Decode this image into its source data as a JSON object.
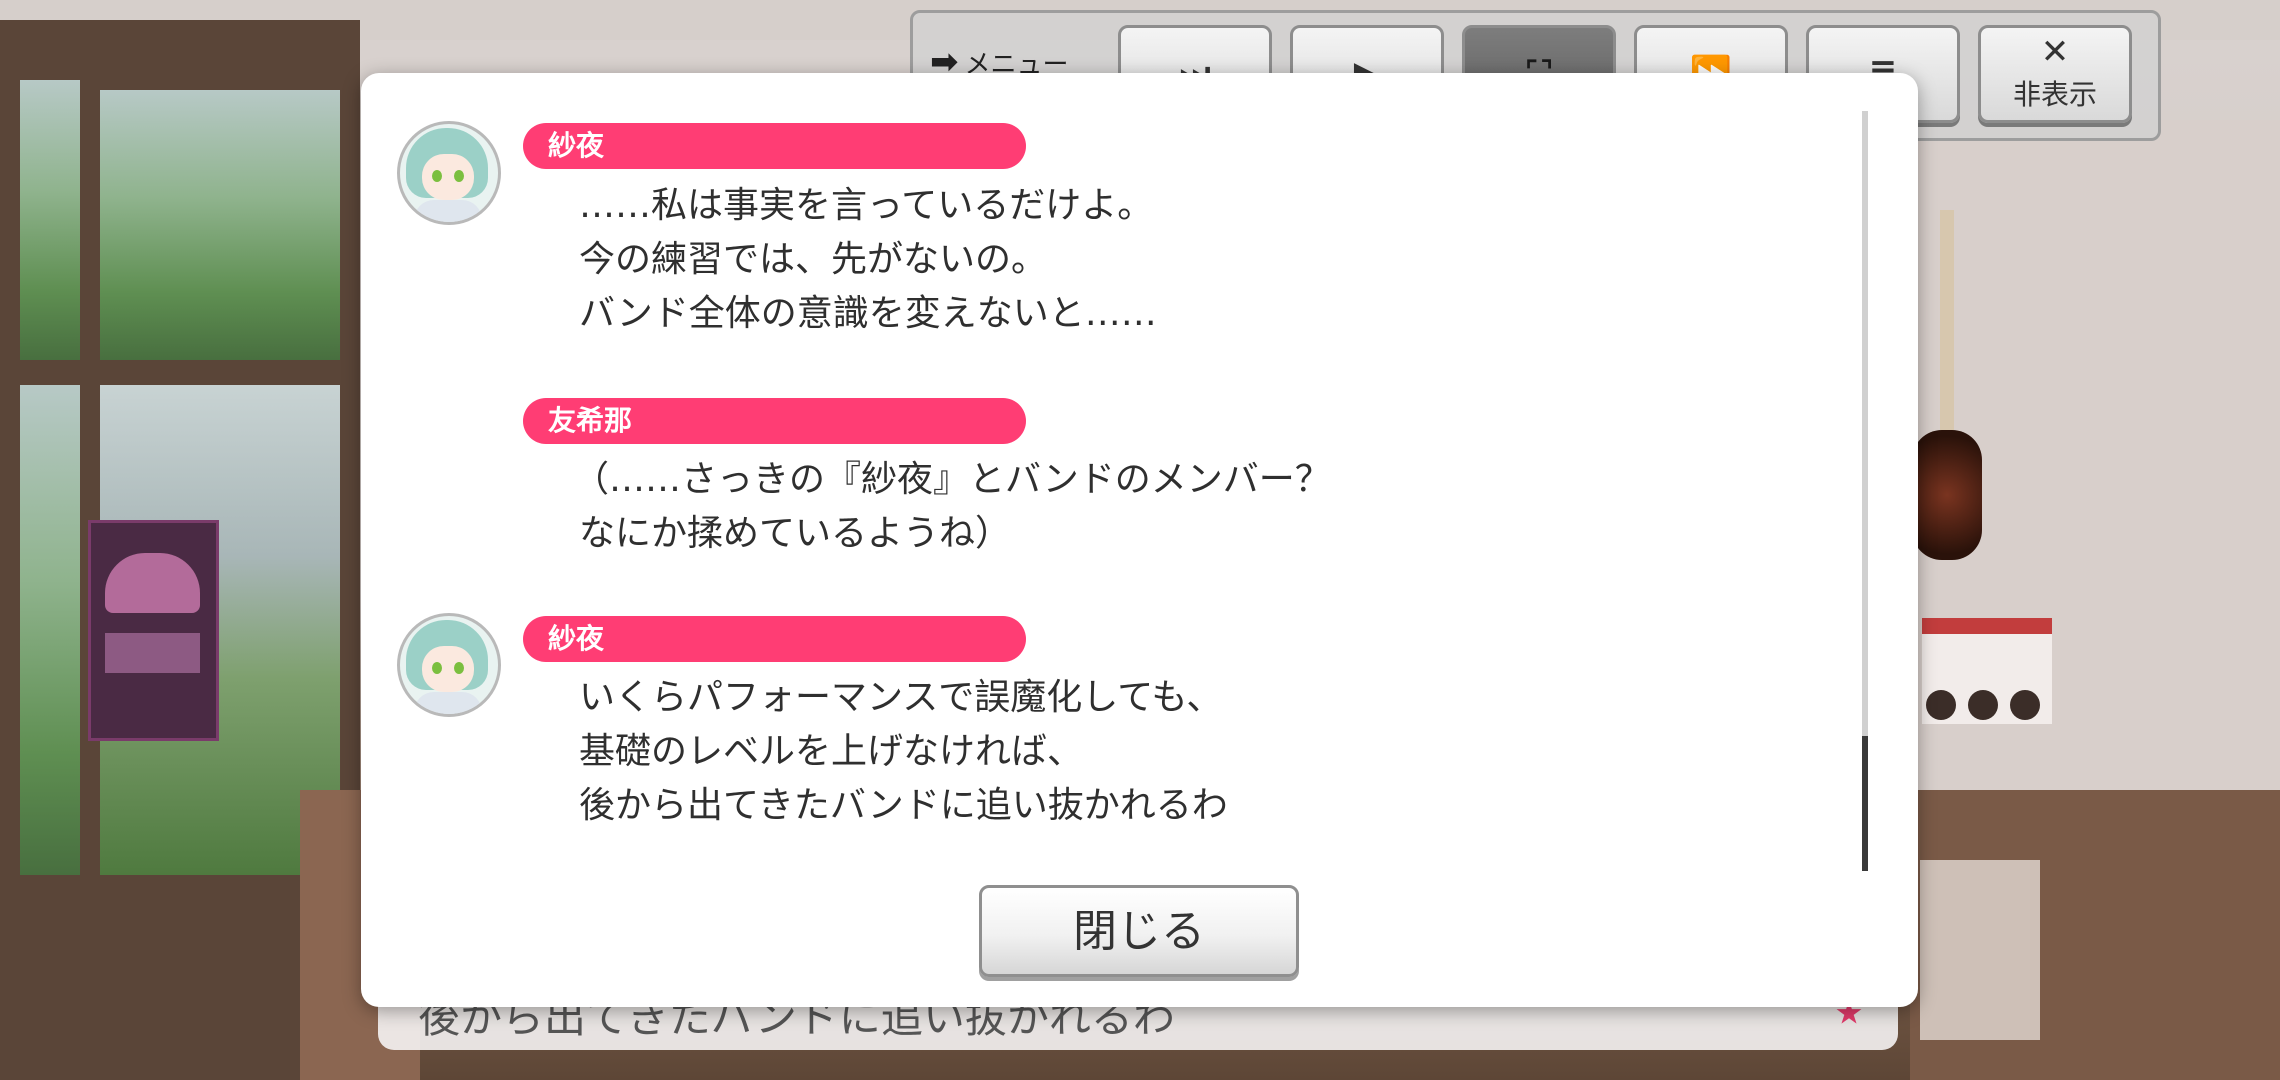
{
  "toolbar": {
    "menu_label": "メニュー",
    "buttons": [
      {
        "icon": "skip-icon",
        "glyph": "⏭"
      },
      {
        "icon": "play-icon",
        "glyph": "▶"
      },
      {
        "icon": "fullscreen-play-icon",
        "glyph": "⛶"
      },
      {
        "icon": "fast-forward-icon",
        "glyph": "⏩"
      },
      {
        "icon": "log-icon",
        "glyph": "≣"
      },
      {
        "icon": "close-icon",
        "glyph": "✕",
        "label": "非表示"
      }
    ]
  },
  "message_box": {
    "text": "後から出てきたバンドに追い抜かれるわ"
  },
  "log": {
    "entries": [
      {
        "speaker": "紗夜",
        "has_avatar": true,
        "lines": [
          "……私は事実を言っているだけよ。",
          "今の練習では、先がないの。",
          "バンド全体の意識を変えないと……"
        ]
      },
      {
        "speaker": "友希那",
        "has_avatar": false,
        "lines": [
          "（……さっきの『紗夜』とバンドのメンバー？",
          "なにか揉めているようね）"
        ]
      },
      {
        "speaker": "紗夜",
        "has_avatar": true,
        "lines": [
          "いくらパフォーマンスで誤魔化しても、",
          "基礎のレベルを上げなければ、",
          "後から出てきたバンドに追い抜かれるわ"
        ]
      }
    ],
    "close_label": "閉じる"
  },
  "colors": {
    "name_tag": "#ff3d74",
    "modal_bg": "#ffffff",
    "text": "#2f2f2f"
  }
}
